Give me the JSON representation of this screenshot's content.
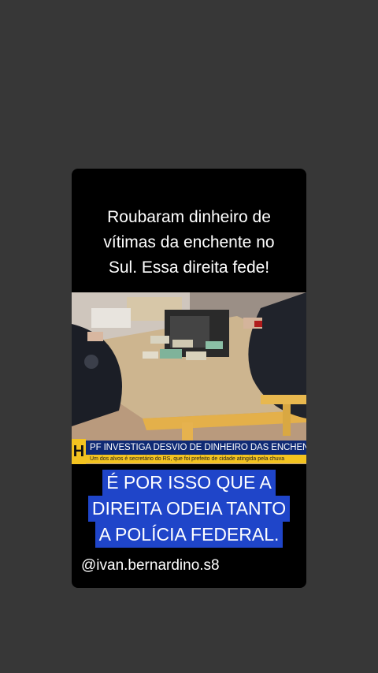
{
  "caption": "Roubaram dinheiro de\nvítimas da enchente no\nSul. Essa direita fede!",
  "news": {
    "logo": "H",
    "headline": "PF INVESTIGA DESVIO DE DINHEIRO DAS ENCHENTES",
    "subline": "Um dos alvos é secretário do RS, que foi prefeito de cidade atingida pela chuva"
  },
  "big_caption_lines": [
    "É POR ISSO QUE A",
    "DIREITA ODEIA TANTO",
    "A POLÍCIA FEDERAL."
  ],
  "handle": "@ivan.bernardino.s8",
  "colors": {
    "page_background": "#373737",
    "card_background": "#000000",
    "caption_highlight": "#1f45c9",
    "news_blue": "#0f2a74",
    "news_yellow": "#f3c320"
  }
}
